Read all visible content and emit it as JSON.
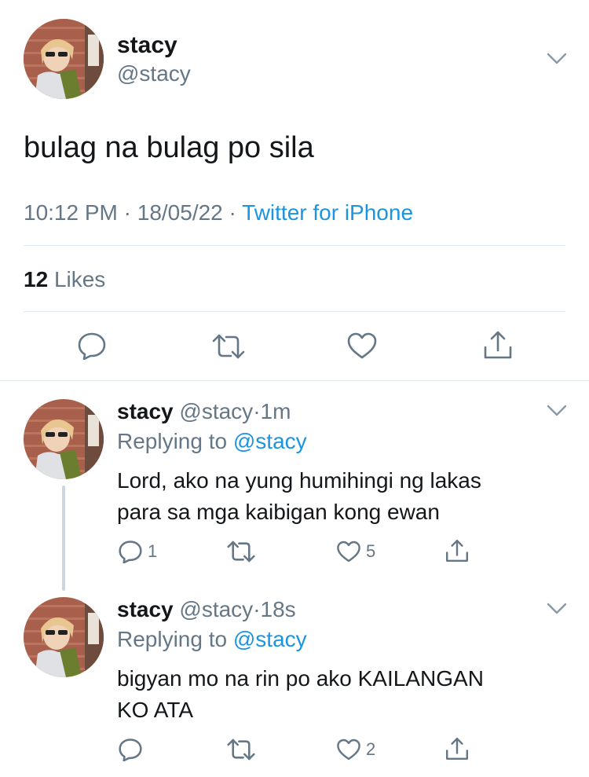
{
  "main_tweet": {
    "display_name": "stacy",
    "handle": "@stacy",
    "text": "bulag na bulag po sila",
    "time": "10:12 PM",
    "sep1": "·",
    "date": "18/05/22",
    "sep2": "·",
    "source": "Twitter for iPhone",
    "likes_count": "12",
    "likes_label": "Likes",
    "icons": [
      "reply-icon",
      "retweet-icon",
      "like-icon",
      "share-icon"
    ]
  },
  "replies": [
    {
      "display_name": "stacy",
      "handle": "@stacy",
      "dot": "·",
      "age": "1m",
      "replying_label": "Replying to",
      "replying_to": "@stacy",
      "text_line1": "Lord, ako na yung humihingi ng lakas",
      "text_line2": "para sa mga kaibigan kong ewan",
      "reply_count": "1",
      "like_count": "5"
    },
    {
      "display_name": "stacy",
      "handle": "@stacy",
      "dot": "·",
      "age": "18s",
      "replying_label": "Replying to",
      "replying_to": "@stacy",
      "text_line1": "bigyan mo na rin po ako KAILANGAN",
      "text_line2": "KO ATA",
      "reply_count": "",
      "like_count": "2"
    }
  ],
  "colors": {
    "text": "#14171a",
    "muted": "#657786",
    "link": "#1b95e0",
    "divider": "#e1e8ed"
  }
}
